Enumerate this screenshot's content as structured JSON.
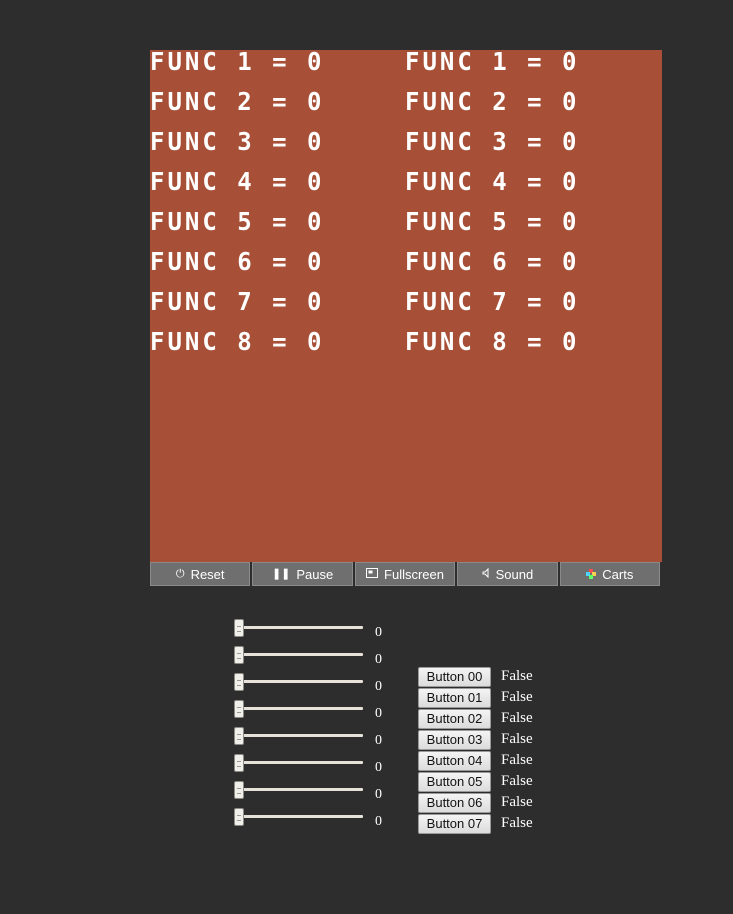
{
  "screen": {
    "background_color": "#a75037",
    "text_color": "#ffffff",
    "left_column": [
      "FUNC 1 = 0",
      "FUNC 2 = 0",
      "FUNC 3 = 0",
      "FUNC 4 = 0",
      "FUNC 5 = 0",
      "FUNC 6 = 0",
      "FUNC 7 = 0",
      "FUNC 8 = 0"
    ],
    "right_column": [
      "FUNC 1 = 0",
      "FUNC 2 = 0",
      "FUNC 3 = 0",
      "FUNC 4 = 0",
      "FUNC 5 = 0",
      "FUNC 6 = 0",
      "FUNC 7 = 0",
      "FUNC 8 = 0"
    ]
  },
  "toolbar": {
    "items": [
      {
        "label": "Reset",
        "icon": "power-icon"
      },
      {
        "label": "Pause",
        "icon": "pause-icon"
      },
      {
        "label": "Fullscreen",
        "icon": "fullscreen-icon"
      },
      {
        "label": "Sound",
        "icon": "speaker-icon"
      },
      {
        "label": "Carts",
        "icon": "carts-icon"
      }
    ]
  },
  "sliders": {
    "values": [
      "0",
      "0",
      "0",
      "0",
      "0",
      "0",
      "0",
      "0"
    ]
  },
  "buttons": {
    "items": [
      {
        "label": "Button 00",
        "state": "False"
      },
      {
        "label": "Button 01",
        "state": "False"
      },
      {
        "label": "Button 02",
        "state": "False"
      },
      {
        "label": "Button 03",
        "state": "False"
      },
      {
        "label": "Button 04",
        "state": "False"
      },
      {
        "label": "Button 05",
        "state": "False"
      },
      {
        "label": "Button 06",
        "state": "False"
      },
      {
        "label": "Button 07",
        "state": "False"
      }
    ]
  }
}
